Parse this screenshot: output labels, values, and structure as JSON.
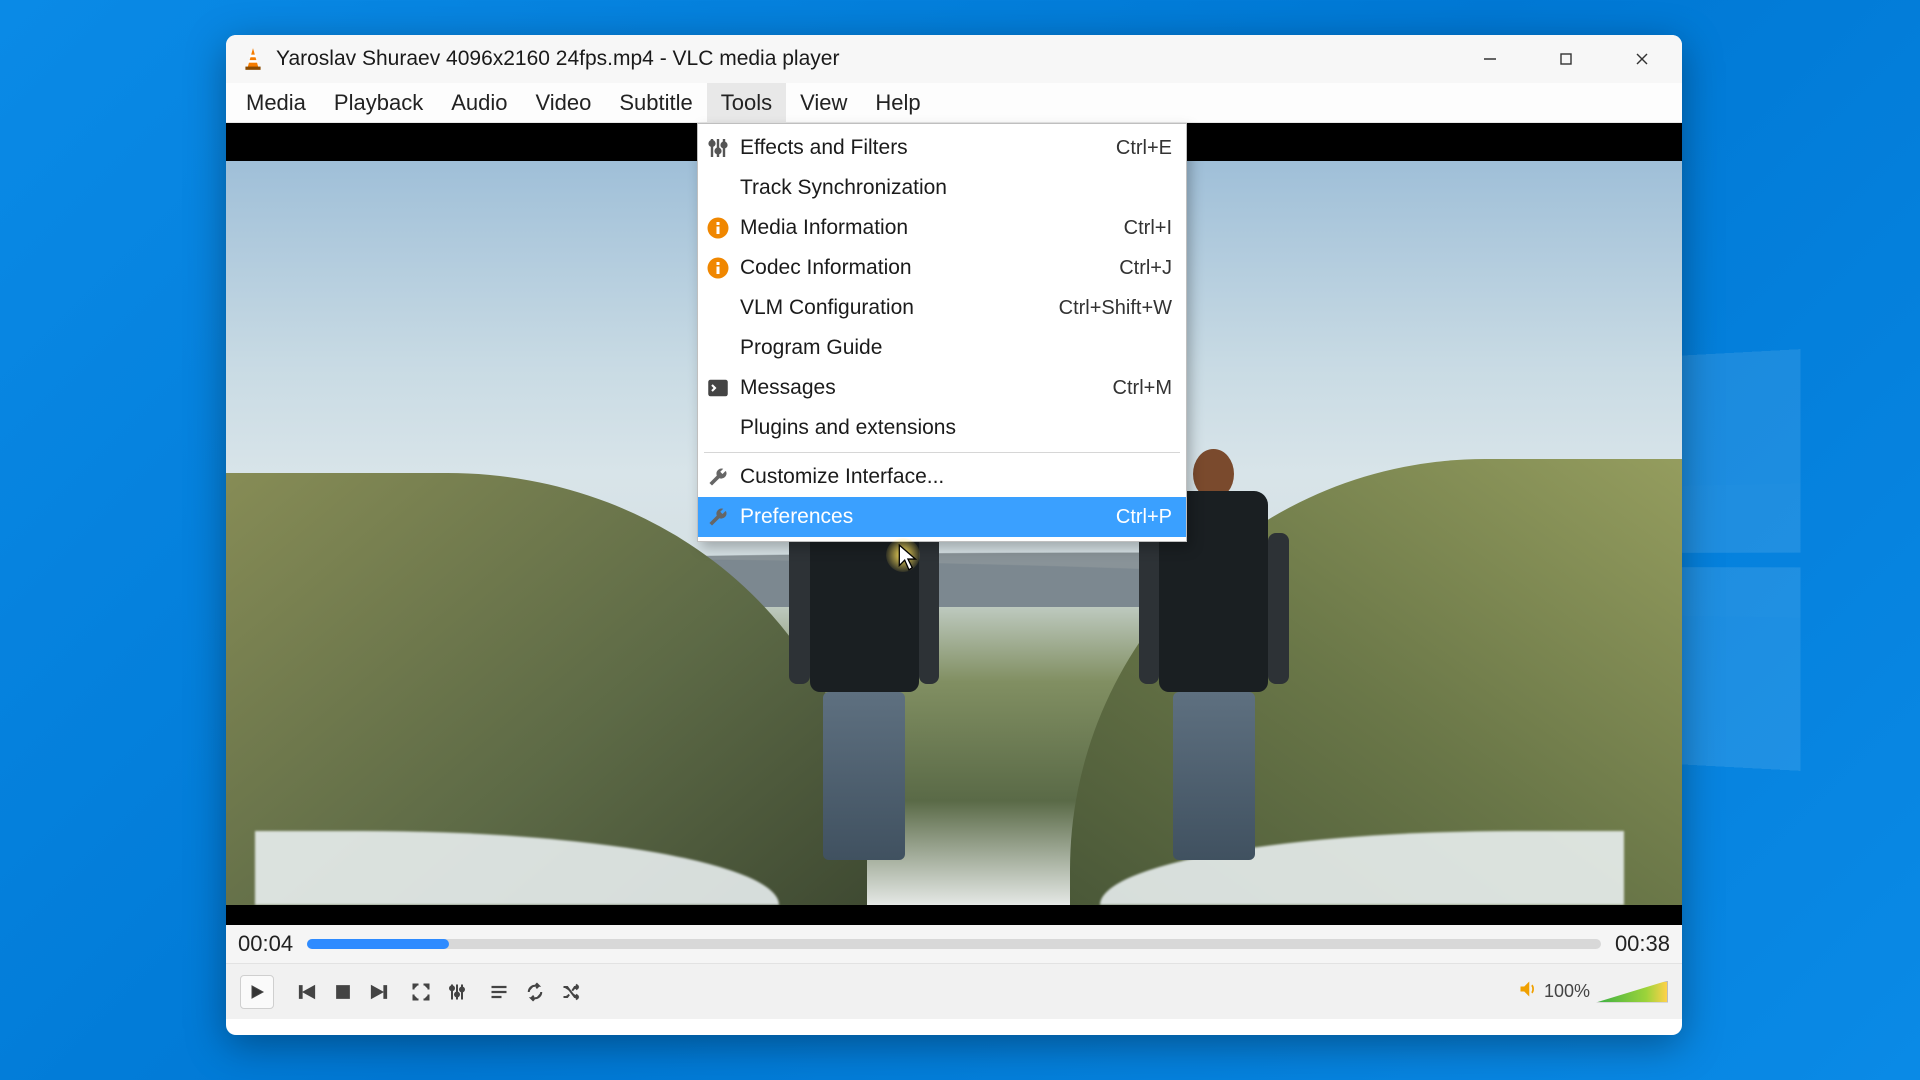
{
  "window": {
    "title": "Yaroslav Shuraev 4096x2160 24fps.mp4 - VLC media player"
  },
  "menubar": {
    "items": [
      {
        "label": "Media"
      },
      {
        "label": "Playback"
      },
      {
        "label": "Audio"
      },
      {
        "label": "Video"
      },
      {
        "label": "Subtitle"
      },
      {
        "label": "Tools"
      },
      {
        "label": "View"
      },
      {
        "label": "Help"
      }
    ],
    "open_index": 5
  },
  "tools_menu": {
    "items": [
      {
        "icon": "sliders",
        "label": "Effects and Filters",
        "shortcut": "Ctrl+E"
      },
      {
        "icon": "",
        "label": "Track Synchronization",
        "shortcut": ""
      },
      {
        "icon": "info",
        "label": "Media Information",
        "shortcut": "Ctrl+I"
      },
      {
        "icon": "info",
        "label": "Codec Information",
        "shortcut": "Ctrl+J"
      },
      {
        "icon": "",
        "label": "VLM Configuration",
        "shortcut": "Ctrl+Shift+W"
      },
      {
        "icon": "",
        "label": "Program Guide",
        "shortcut": ""
      },
      {
        "icon": "terminal",
        "label": "Messages",
        "shortcut": "Ctrl+M"
      },
      {
        "icon": "",
        "label": "Plugins and extensions",
        "shortcut": ""
      },
      {
        "sep": true
      },
      {
        "icon": "wrench",
        "label": "Customize Interface...",
        "shortcut": ""
      },
      {
        "icon": "wrench",
        "label": "Preferences",
        "shortcut": "Ctrl+P",
        "highlighted": true
      }
    ]
  },
  "playback": {
    "elapsed": "00:04",
    "total": "00:38",
    "progress_pct": 11
  },
  "volume": {
    "label": "100%"
  }
}
